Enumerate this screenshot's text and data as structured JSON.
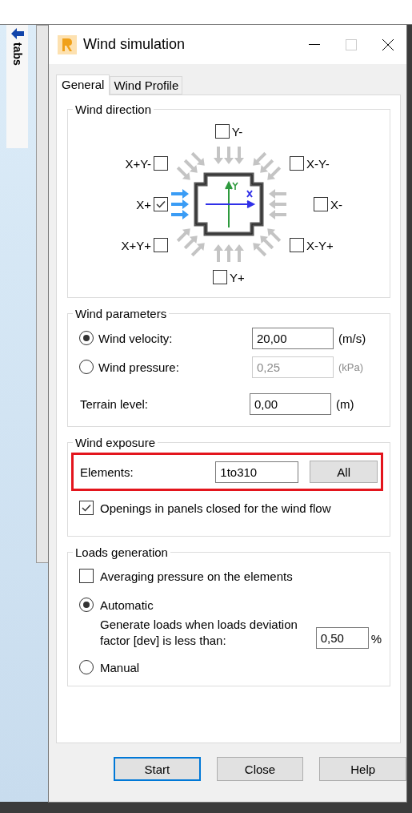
{
  "side_panel": {
    "label": "tabs"
  },
  "window": {
    "title": "Wind simulation"
  },
  "tabs": [
    {
      "label": "General",
      "selected": true
    },
    {
      "label": "Wind Profile",
      "selected": false
    }
  ],
  "wind_direction": {
    "title": "Wind direction",
    "directions": [
      {
        "label": "Y-",
        "checked": false
      },
      {
        "label": "X+Y-",
        "checked": false
      },
      {
        "label": "X-Y-",
        "checked": false
      },
      {
        "label": "X+",
        "checked": true
      },
      {
        "label": "X-",
        "checked": false
      },
      {
        "label": "X+Y+",
        "checked": false
      },
      {
        "label": "X-Y+",
        "checked": false
      },
      {
        "label": "Y+",
        "checked": false
      }
    ]
  },
  "wind_parameters": {
    "title": "Wind parameters",
    "rows": [
      {
        "kind": "radio",
        "label": "Wind velocity:",
        "selected": true,
        "value": "20,00",
        "unit": "(m/s)",
        "disabled": false
      },
      {
        "kind": "radio",
        "label": "Wind pressure:",
        "selected": false,
        "value": "0,25",
        "unit": "(kPa)",
        "disabled": true
      },
      {
        "kind": "plain",
        "label": "Terrain level:",
        "value": "0,00",
        "unit": "(m)",
        "disabled": false
      }
    ]
  },
  "wind_exposure": {
    "title": "Wind exposure",
    "highlighted": true,
    "elements_label": "Elements:",
    "elements_value": "1to310",
    "all_button": "All",
    "openings": {
      "label": "Openings in panels closed for the wind flow",
      "checked": true
    }
  },
  "loads_generation": {
    "title": "Loads generation",
    "averaging": {
      "label": "Averaging pressure on the elements",
      "checked": false
    },
    "modes": [
      {
        "label": "Automatic",
        "selected": true
      },
      {
        "label": "Manual",
        "selected": false
      }
    ],
    "deviation_text": "Generate loads when loads deviation factor [dev] is less than:",
    "deviation_value": "0,50",
    "deviation_unit": "%"
  },
  "buttons": [
    {
      "label": "Start",
      "default": true
    },
    {
      "label": "Close",
      "default": false
    },
    {
      "label": "Help",
      "default": false
    }
  ]
}
